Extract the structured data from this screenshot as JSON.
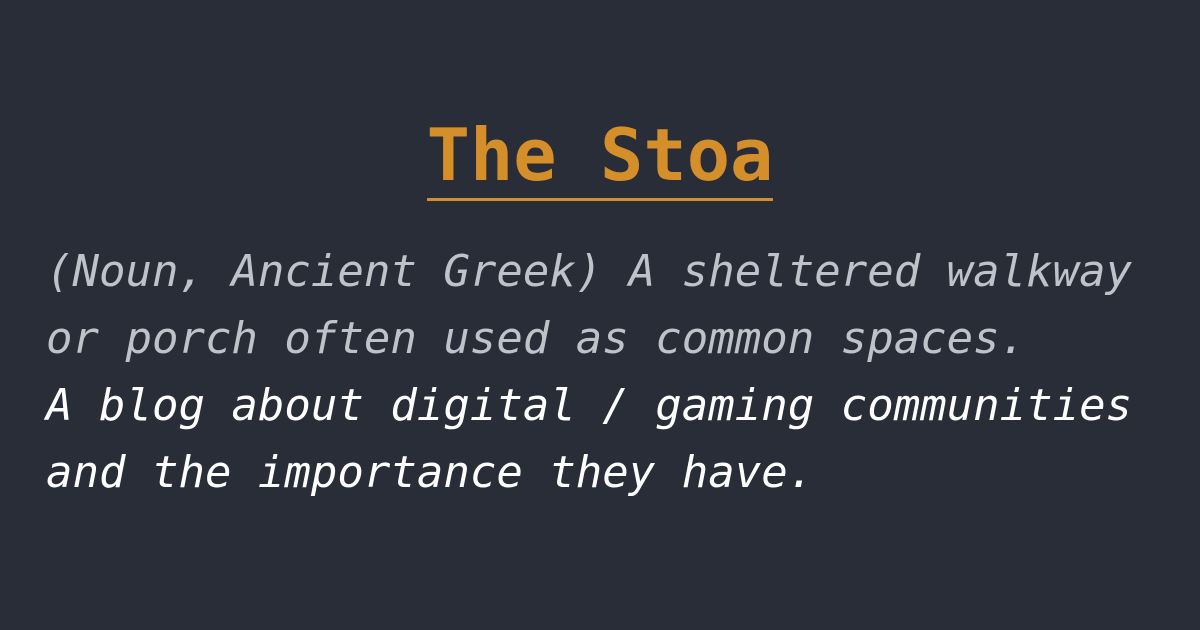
{
  "site": {
    "title": "The Stoa"
  },
  "definition": {
    "lines": [
      "(Noun, Ancient Greek) A sheltered walkway",
      "or porch often used as common spaces."
    ]
  },
  "tagline": {
    "lines": [
      "A blog about digital / gaming communities",
      "and the importance they have."
    ]
  },
  "colors": {
    "background": "#282d37",
    "accent": "#d48f2a",
    "definition_text": "#bfc2c8",
    "tagline_text": "#ffffff"
  }
}
